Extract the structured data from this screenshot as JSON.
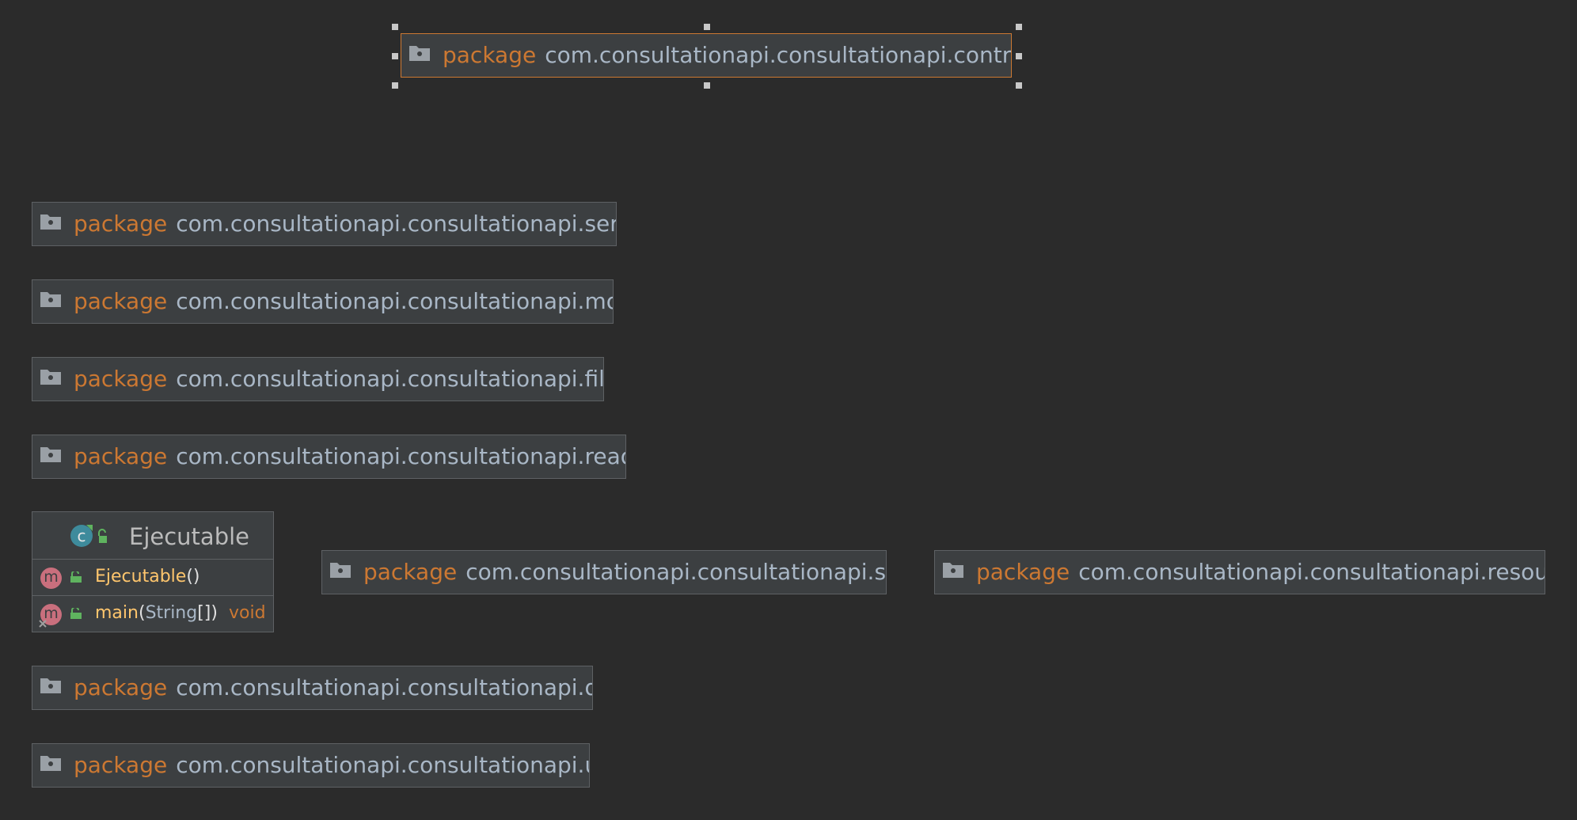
{
  "colors": {
    "background": "#2b2b2b",
    "node_fill": "#3c3f41",
    "node_border": "#5e6164",
    "keyword": "#cc7832",
    "package_name": "#a9b7c6",
    "method_name": "#ffc66d",
    "selection": "#cc7832"
  },
  "packages": [
    {
      "keyword": "package",
      "name": "com.consultationapi.consultationapi.controller",
      "selected": true,
      "icon": "folder-icon"
    },
    {
      "keyword": "package",
      "name": "com.consultationapi.consultationapi.service",
      "icon": "folder-icon"
    },
    {
      "keyword": "package",
      "name": "com.consultationapi.consultationapi.model",
      "icon": "folder-icon"
    },
    {
      "keyword": "package",
      "name": "com.consultationapi.consultationapi.filters",
      "icon": "folder-icon"
    },
    {
      "keyword": "package",
      "name": "com.consultationapi.consultationapi.readFile",
      "icon": "folder-icon"
    },
    {
      "keyword": "package",
      "name": "com.consultationapi.consultationapi.state",
      "icon": "folder-icon"
    },
    {
      "keyword": "package",
      "name": "com.consultationapi.consultationapi.resource",
      "icon": "folder-icon"
    },
    {
      "keyword": "package",
      "name": "com.consultationapi.consultationapi.data",
      "icon": "folder-icon"
    },
    {
      "keyword": "package",
      "name": "com.consultationapi.consultationapi.utils",
      "icon": "folder-icon"
    }
  ],
  "class_node": {
    "name": "Ejecutable",
    "icon": "class-icon",
    "methods": [
      {
        "name": "Ejecutable",
        "params_open": "(",
        "params": "",
        "params_close": ")",
        "return_type": "",
        "icon": "method-icon"
      },
      {
        "name": "main",
        "params_open": "(",
        "params": "String",
        "array_brackets": "[]",
        "params_close": ")",
        "return_type": "void",
        "icon": "method-icon"
      }
    ]
  }
}
